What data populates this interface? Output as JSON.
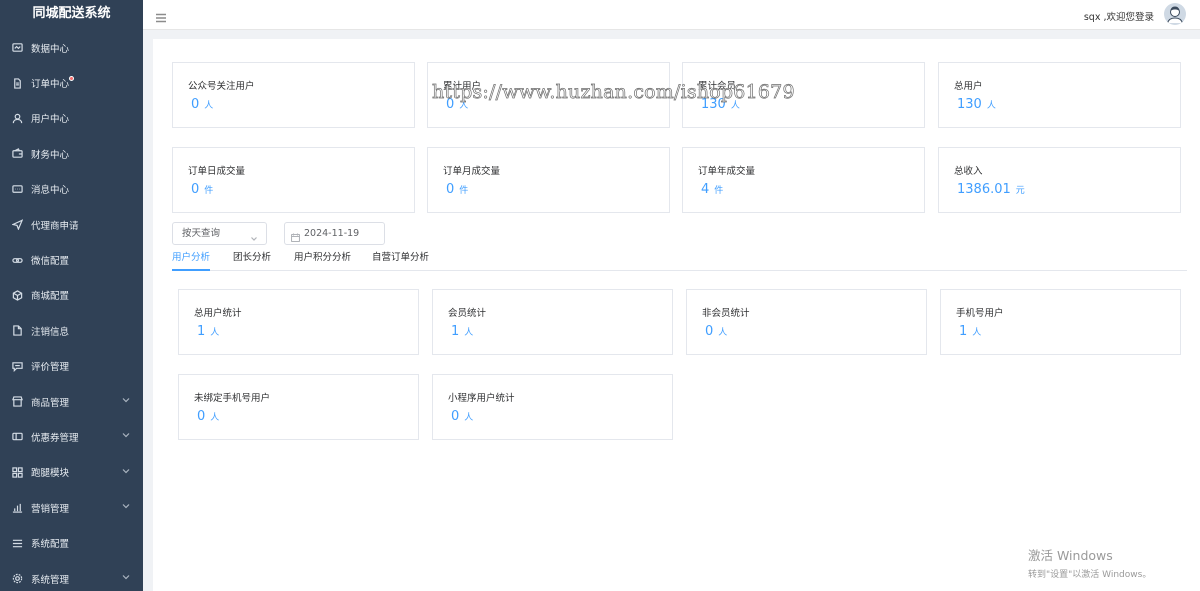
{
  "sidebar": {
    "brand": "同城配送系统",
    "items": [
      {
        "label": "数据中心",
        "icon": "dashboard-icon"
      },
      {
        "label": "订单中心",
        "icon": "document-icon",
        "badge": true
      },
      {
        "label": "用户中心",
        "icon": "user-icon"
      },
      {
        "label": "财务中心",
        "icon": "wallet-icon"
      },
      {
        "label": "消息中心",
        "icon": "message-icon"
      },
      {
        "label": "代理商申请",
        "icon": "send-icon"
      },
      {
        "label": "微信配置",
        "icon": "link-icon"
      },
      {
        "label": "商城配置",
        "icon": "box-icon"
      },
      {
        "label": "注销信息",
        "icon": "file-icon"
      },
      {
        "label": "评价管理",
        "icon": "comment-icon"
      },
      {
        "label": "商品管理",
        "icon": "shop-icon",
        "expandable": true
      },
      {
        "label": "优惠券管理",
        "icon": "coupon-icon",
        "expandable": true
      },
      {
        "label": "跑腿模块",
        "icon": "grid-icon",
        "expandable": true
      },
      {
        "label": "营销管理",
        "icon": "chart-icon",
        "expandable": true
      },
      {
        "label": "系统配置",
        "icon": "list-icon"
      },
      {
        "label": "系统管理",
        "icon": "gear-icon",
        "expandable": true
      }
    ]
  },
  "header": {
    "user_text": "sqx ,欢迎您登录"
  },
  "overview": {
    "cards": [
      {
        "label": "公众号关注用户",
        "value": "0",
        "unit": "人"
      },
      {
        "label": "累计用户",
        "value": "0",
        "unit": "人"
      },
      {
        "label": "累计会员",
        "value": "130",
        "unit": "人"
      },
      {
        "label": "总用户",
        "value": "130",
        "unit": "人"
      },
      {
        "label": "订单日成交量",
        "value": "0",
        "unit": "件"
      },
      {
        "label": "订单月成交量",
        "value": "0",
        "unit": "件"
      },
      {
        "label": "订单年成交量",
        "value": "4",
        "unit": "件"
      },
      {
        "label": "总收入",
        "value": "1386.01",
        "unit": "元"
      }
    ]
  },
  "filters": {
    "period_select": "按天查询",
    "date": "2024-11-19"
  },
  "tabs": [
    {
      "label": "用户分析",
      "active": true
    },
    {
      "label": "团长分析",
      "active": false
    },
    {
      "label": "用户积分分析",
      "active": false
    },
    {
      "label": "自营订单分析",
      "active": false
    }
  ],
  "stats": {
    "cards": [
      {
        "label": "总用户统计",
        "value": "1",
        "unit": "人"
      },
      {
        "label": "会员统计",
        "value": "1",
        "unit": "人"
      },
      {
        "label": "非会员统计",
        "value": "0",
        "unit": "人"
      },
      {
        "label": "手机号用户",
        "value": "1",
        "unit": "人"
      },
      {
        "label": "未绑定手机号用户",
        "value": "0",
        "unit": "人"
      },
      {
        "label": "小程序用户统计",
        "value": "0",
        "unit": "人"
      }
    ]
  },
  "overlays": {
    "watermark": "https://www.huzhan.com/ishop61679",
    "activate_title": "激活 Windows",
    "activate_sub": "转到\"设置\"以激活 Windows。"
  },
  "colors": {
    "sidebar_bg": "#304156",
    "accent": "#409eff"
  }
}
